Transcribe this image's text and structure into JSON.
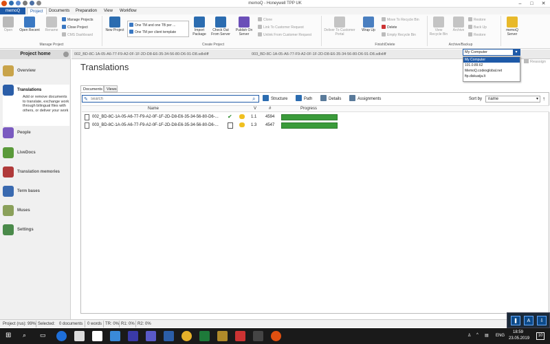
{
  "window": {
    "title": "memoQ - Honeywell TPP UK"
  },
  "ribbon_tabs": [
    "memoQ",
    "Project",
    "Documents",
    "Preparation",
    "View",
    "Workflow"
  ],
  "ribbon": {
    "open": "Open",
    "open_recent": "Open Recent",
    "rename": "Rename",
    "manage_projects": "Manage Projects",
    "close_project": "Close Project",
    "cms_dashboard": "CMS Dashboard",
    "group_manage": "Manage Project",
    "new_project": "New Project",
    "template_1": "One TM and one TB per ...",
    "template_2": "One TM per client template",
    "import_package": "Import Package",
    "check_out": "Check Out From Server",
    "publish": "Publish On Server",
    "clone": "Clone",
    "link_customer": "Link To Customer Request",
    "unlink_customer": "Unlink From Customer Request",
    "group_create": "Create Project",
    "deliver": "Deliver To Customer Portal",
    "wrap_up": "Wrap Up",
    "move_recycle": "Move To Recycle Bin",
    "delete": "Delete",
    "empty_recycle": "Empty Recycle Bin",
    "group_finish": "Finish/Delete",
    "view_recycle": "View Recycle Bin",
    "archive": "Archive",
    "restore1": "Restore",
    "backup": "Back Up",
    "restore2": "Restore",
    "group_archive": "Archive/Backup",
    "memoq_server": "memoQ Server"
  },
  "sidebar": {
    "header": "Project home",
    "items": [
      {
        "label": "Overview"
      },
      {
        "label": "Translations",
        "description": "Add or remove documents to translate, exchange work through bilingual files with others, or deliver your work"
      },
      {
        "label": "People"
      },
      {
        "label": "LiveDocs"
      },
      {
        "label": "Translation memories"
      },
      {
        "label": "Term bases"
      },
      {
        "label": "Muses"
      },
      {
        "label": "Settings"
      }
    ]
  },
  "doc_tabs": [
    "002_BD-8C-1A-05-A6-77-F9-A2-0F-1F-2D-D8-E6-35-34-56-80-D6-91-D8.sdlxliff",
    "003_BD-8C-1A-05-A6-77-F9-A2-0F-1F-2D-D8-E6-35-34-56-80-D6-91-D8.sdlxliff"
  ],
  "page_title": "Translations",
  "server": {
    "selected": "My Computer",
    "options": [
      "My Computer",
      "101.0.89.62",
      "MemoQ.codexglobal.net",
      "ftp.diskusija.lt"
    ],
    "reassign": "Reassign"
  },
  "subtabs": [
    "Documents",
    "Views"
  ],
  "toolbar": {
    "search_placeholder": "search",
    "structure": "Structure",
    "path": "Path",
    "details": "Details",
    "assignments": "Assignments",
    "sort_by": "Sort by",
    "sort_value": "name"
  },
  "table": {
    "headers": {
      "name": "Name",
      "v": "V",
      "num": "#",
      "progress": "Progress"
    },
    "rows": [
      {
        "name": "002_BD-8C-1A-05-A6-77-F9-A2-0F-1F-2D-D8-E6-35-34-56-80-D6-...",
        "v": "1.1",
        "num": "4594",
        "progress": 1.0
      },
      {
        "name": "003_BD-8C-1A-05-A6-77-F9-A2-0F-1F-2D-D8-E6-35-34-56-80-D6-...",
        "v": "1.3",
        "num": "4547",
        "progress": 1.0
      }
    ]
  },
  "status": {
    "project": "Project (rus): 99%",
    "selected": "Selected:",
    "docs": "0 documents",
    "words": "0 words",
    "tr": "TR: 0%",
    "r1": "R1: 0%",
    "r2": "R2: 0%"
  },
  "taskbar": {
    "lang": "ENG",
    "time": "18:59",
    "date": "23.05.2019",
    "notif": "10"
  },
  "colors": {
    "accent": "#1e5aa8",
    "progress": "#3a9b3a"
  }
}
